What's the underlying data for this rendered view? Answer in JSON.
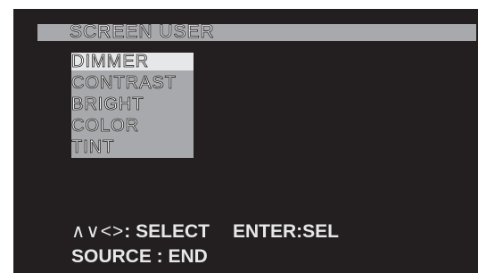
{
  "title": "SCREEN USER",
  "menu": {
    "items": [
      {
        "label": "DIMMER",
        "selected": true
      },
      {
        "label": "CONTRAST",
        "selected": false
      },
      {
        "label": "BRIGHT",
        "selected": false
      },
      {
        "label": "COLOR",
        "selected": false
      },
      {
        "label": "TINT",
        "selected": false
      }
    ]
  },
  "footer": {
    "nav_arrows": "∧∨<>",
    "select_label": ": SELECT",
    "enter_label": "ENTER:SEL",
    "source_label": "SOURCE : END"
  },
  "colors": {
    "background": "#231f20",
    "highlight_bar": "#a7a9ac",
    "selected_item": "#e6e7e8",
    "text": "#ffffff"
  }
}
